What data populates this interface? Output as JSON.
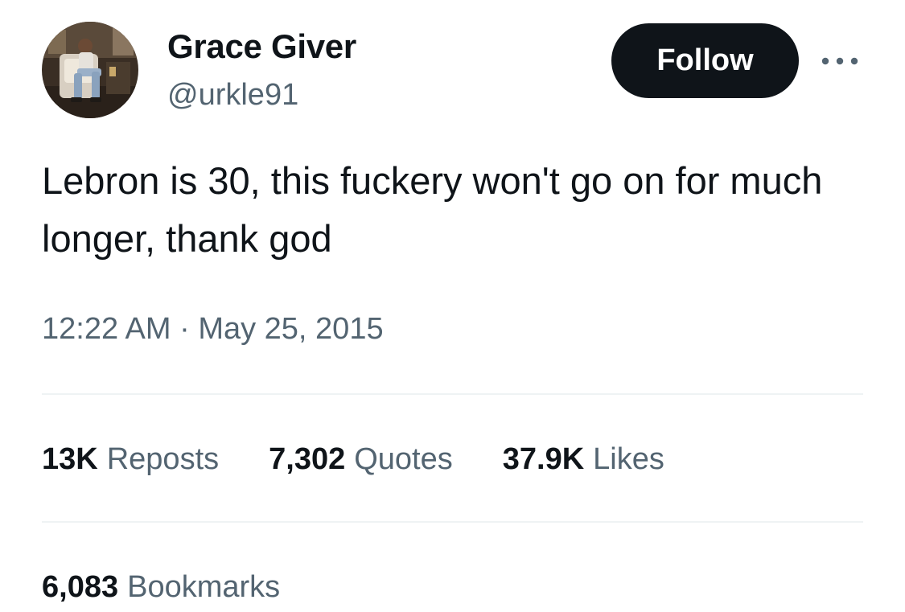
{
  "user": {
    "display_name": "Grace Giver",
    "handle": "@urkle91",
    "avatar": "profile-photo"
  },
  "follow_label": "Follow",
  "more_icon": "more-horizontal-icon",
  "tweet": {
    "text": "Lebron is 30, this fuckery won't go on for much longer, thank god",
    "timestamp": "12:22 AM · May 25, 2015"
  },
  "stats": {
    "reposts": {
      "count": "13K",
      "label": "Reposts"
    },
    "quotes": {
      "count": "7,302",
      "label": "Quotes"
    },
    "likes": {
      "count": "37.9K",
      "label": "Likes"
    },
    "bookmarks": {
      "count": "6,083",
      "label": "Bookmarks"
    }
  },
  "colors": {
    "text_primary": "#0f1419",
    "text_secondary": "#536471",
    "button_bg": "#0f1419",
    "button_text": "#ffffff",
    "divider": "#eff3f4"
  }
}
